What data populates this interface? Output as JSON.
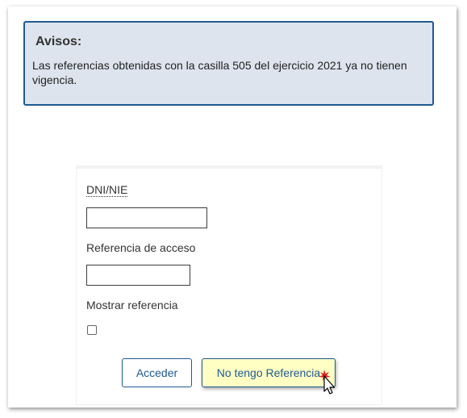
{
  "notice": {
    "title": "Avisos:",
    "text": "Las referencias obtenidas con la casilla 505 del ejercicio 2021 ya no tienen vigencia."
  },
  "form": {
    "dni_label": "DNI/NIE",
    "dni_value": "",
    "ref_label": "Referencia de acceso",
    "ref_value": "",
    "show_ref_label": "Mostrar referencia",
    "show_ref_checked": false
  },
  "buttons": {
    "access_label": "Acceder",
    "no_ref_label": "No tengo Referencia"
  },
  "colors": {
    "accent": "#1f5a91",
    "notice_bg": "#dde4ee",
    "highlight_button_bg": "#ffffc4",
    "click_marker": "#e02020"
  },
  "icons": {
    "pointer": "mouse-pointer-icon",
    "click": "click-burst-icon"
  }
}
